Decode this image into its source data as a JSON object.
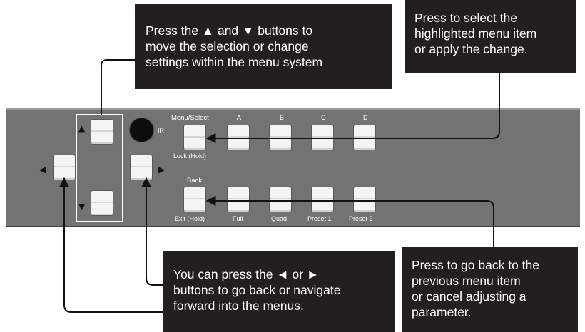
{
  "callouts": {
    "updown": "Press the ▲ and ▼ buttons to\nmove the selection or change\nsettings within the menu system",
    "select": "Press to select the\nhighlighted menu item\nor apply the change.",
    "leftright": "You can press the ◄ or ►\nbuttons to go back or navigate\nforward into the menus.",
    "back": "Press to go back to the\nprevious menu item\nor cancel adjusting a\nparameter."
  },
  "panel": {
    "ir_label": "IR",
    "menu_select_label": "Menu/Select",
    "lock_label": "Lock (Hold)",
    "back_label": "Back",
    "exit_label": "Exit (Hold)",
    "top_row_labels": [
      "A",
      "B",
      "C",
      "D"
    ],
    "bottom_row_labels": [
      "Full",
      "Quad",
      "Preset 1",
      "Preset 2"
    ],
    "arrow_up": "▲",
    "arrow_down": "▼",
    "arrow_left": "◀",
    "arrow_right": "▶"
  },
  "colors": {
    "callout_bg": "#231f20",
    "panel_bg": "#737373",
    "button": "#f4f4f4"
  }
}
